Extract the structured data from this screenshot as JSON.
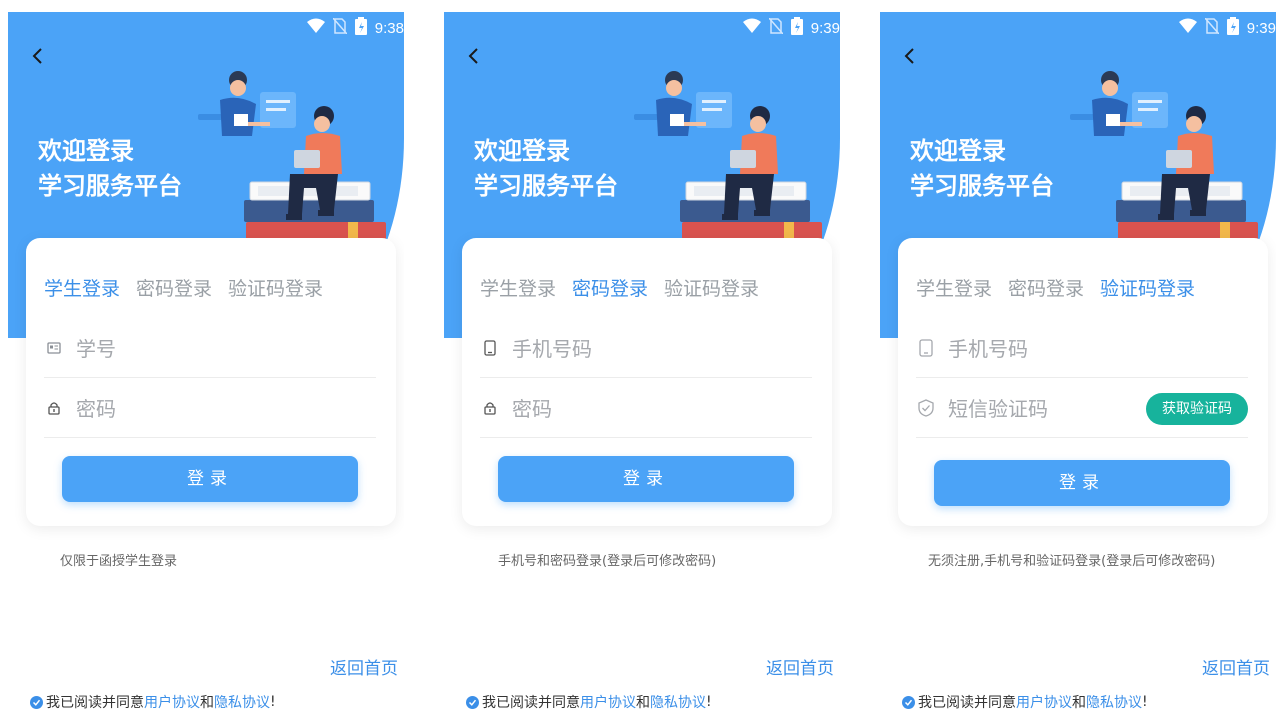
{
  "status": {
    "time_1": "9:38",
    "time_2": "9:39",
    "time_3": "9:39"
  },
  "hero": {
    "title_line1": "欢迎登录",
    "title_line2": "学习服务平台"
  },
  "tabs": {
    "student": "学生登录",
    "password": "密码登录",
    "sms": "验证码登录"
  },
  "screens": [
    {
      "active_tab": "student",
      "field1_placeholder": "学号",
      "field2_placeholder": "密码",
      "login_label": "登录",
      "note": "仅限于函授学生登录"
    },
    {
      "active_tab": "password",
      "field1_placeholder": "手机号码",
      "field2_placeholder": "密码",
      "login_label": "登录",
      "note": "手机号和密码登录(登录后可修改密码)"
    },
    {
      "active_tab": "sms",
      "field1_placeholder": "手机号码",
      "field2_placeholder": "短信验证码",
      "sms_button": "获取验证码",
      "login_label": "登录",
      "note": "无须注册,手机号和验证码登录(登录后可修改密码)"
    }
  ],
  "footer": {
    "home_link": "返回首页",
    "agree_prefix": "我已阅读并同意",
    "user_agreement": "用户协议",
    "and": "和",
    "privacy_agreement": "隐私协议",
    "suffix": "!"
  },
  "colors": {
    "primary": "#4ba3f7",
    "link": "#3b8fe8",
    "sms_button": "#17b39c"
  },
  "icons": [
    "back-arrow-icon",
    "wifi-icon",
    "no-sim-icon",
    "battery-icon",
    "id-card-icon",
    "lock-icon",
    "phone-icon",
    "shield-check-icon",
    "check-circle-icon"
  ]
}
